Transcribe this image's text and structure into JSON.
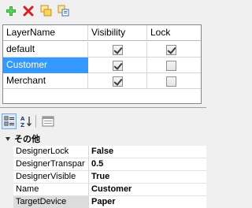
{
  "toolbar": {
    "buttons": [
      {
        "icon": "add-icon",
        "color": "#22a822"
      },
      {
        "icon": "delete-icon",
        "color": "#d81e1e"
      },
      {
        "icon": "copy-icon",
        "color": "#e8b020"
      },
      {
        "icon": "paste-icon",
        "color": "#e8b020"
      }
    ]
  },
  "layers": {
    "columns": [
      "LayerName",
      "Visibility",
      "Lock"
    ],
    "rows": [
      {
        "name": "default",
        "visible": true,
        "locked": true,
        "selected": false
      },
      {
        "name": "Customer",
        "visible": true,
        "locked": false,
        "selected": true
      },
      {
        "name": "Merchant",
        "visible": true,
        "locked": false,
        "selected": false
      }
    ]
  },
  "property_toolbar": {
    "buttons": [
      {
        "icon": "categorized-icon",
        "active": true
      },
      {
        "icon": "alphabetical-sort-icon",
        "active": false
      },
      {
        "icon": "property-pages-icon",
        "active": false
      }
    ]
  },
  "properties": {
    "category": "その他",
    "rows": [
      {
        "name": "DesignerLock",
        "value": "False",
        "selected": false
      },
      {
        "name": "DesignerTranspar",
        "value": "0.5",
        "selected": false
      },
      {
        "name": "DesignerVisible",
        "value": "True",
        "selected": false
      },
      {
        "name": "Name",
        "value": "Customer",
        "selected": false
      },
      {
        "name": "TargetDevice",
        "value": "Paper",
        "selected": true
      }
    ]
  },
  "colors": {
    "selection": "#3399ff",
    "grid_border": "#828790"
  }
}
